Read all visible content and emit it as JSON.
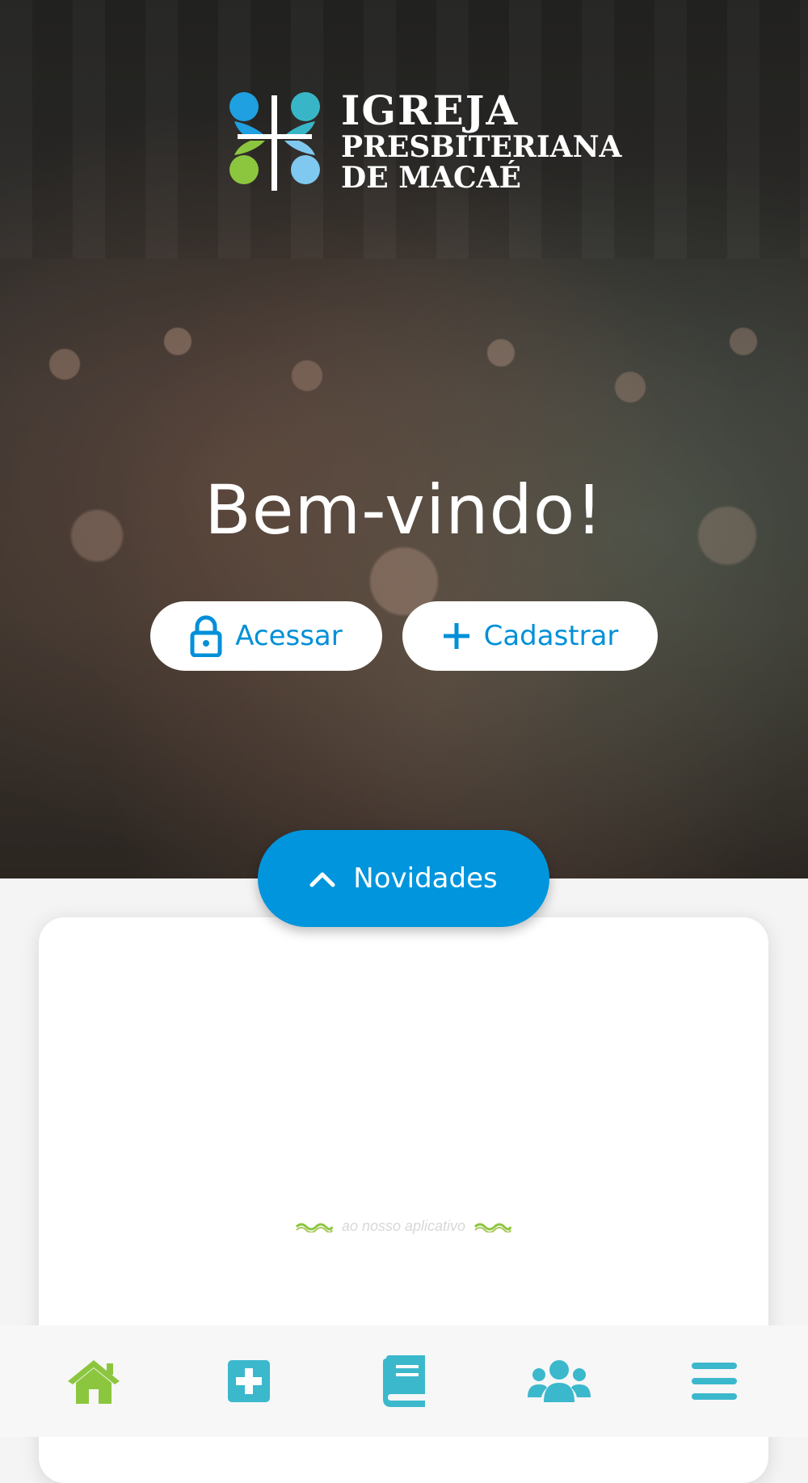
{
  "logo": {
    "line1": "IGREJA",
    "line2": "PRESBITERIANA",
    "line3": "DE MACAÉ",
    "icon": "church-cross-logo"
  },
  "hero": {
    "welcome": "Bem-vindo!",
    "login_label": "Acessar",
    "login_icon": "lock-icon",
    "signup_label": "Cadastrar",
    "signup_icon": "plus-icon"
  },
  "news": {
    "label": "Novidades",
    "icon": "chevron-up-icon"
  },
  "card": {
    "tagline": "ao nosso aplicativo"
  },
  "bottom_nav": {
    "items": [
      {
        "name": "home",
        "icon": "home-icon",
        "color": "#8cc63f"
      },
      {
        "name": "add",
        "icon": "plus-square-icon",
        "color": "#3bb8cc"
      },
      {
        "name": "bible",
        "icon": "book-icon",
        "color": "#3bb8cc"
      },
      {
        "name": "groups",
        "icon": "users-icon",
        "color": "#3bb8cc"
      },
      {
        "name": "menu",
        "icon": "hamburger-icon",
        "color": "#3bb8cc"
      }
    ]
  },
  "colors": {
    "primary": "#0095dc",
    "accent_green": "#8cc63f",
    "accent_teal": "#3bb8cc"
  }
}
